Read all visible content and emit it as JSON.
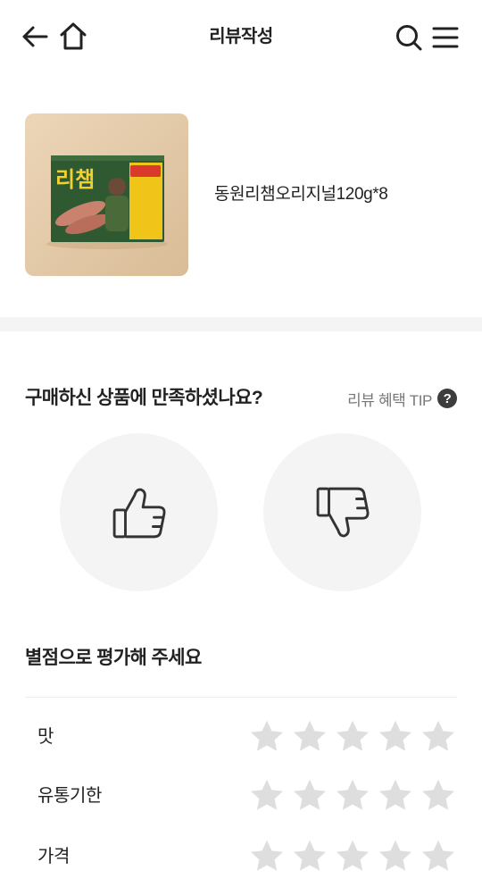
{
  "header": {
    "title": "리뷰작성",
    "icons": [
      "back-arrow-icon",
      "home-icon",
      "search-icon",
      "menu-icon"
    ]
  },
  "product": {
    "name": "동원리챔오리지널120g*8",
    "package_logo": "리챔"
  },
  "satisfaction": {
    "question": "구매하신 상품에 만족하셨나요?",
    "tip_label": "리뷰 혜택 TIP",
    "tip_glyph": "?",
    "options": [
      "thumbs-up-icon",
      "thumbs-down-icon"
    ]
  },
  "rating": {
    "heading": "별점으로 평가해 주세요",
    "items": [
      {
        "key": "taste",
        "label": "맛",
        "value": 0,
        "max": 5
      },
      {
        "key": "expiry",
        "label": "유통기한",
        "value": 0,
        "max": 5
      },
      {
        "key": "price",
        "label": "가격",
        "value": 0,
        "max": 5
      }
    ]
  },
  "colors": {
    "text": "#222222",
    "muted": "#777777",
    "circle_bg": "#f4f4f4",
    "star_empty": "#dedede",
    "star_filled": "#ffb400"
  }
}
